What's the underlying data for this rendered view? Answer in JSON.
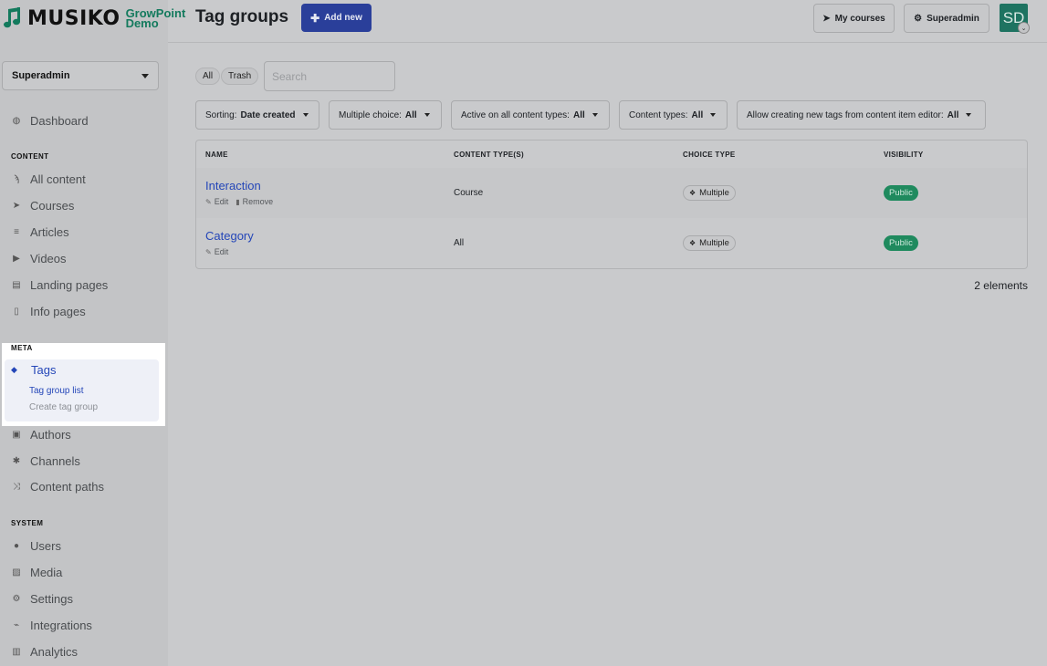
{
  "brand": {
    "name": "MUSIKO",
    "sub1": "GrowPoint",
    "sub2": "Demo"
  },
  "sidebar": {
    "role_select": "Superadmin",
    "dashboard": "Dashboard",
    "content_label": "CONTENT",
    "content_items": [
      "All content",
      "Courses",
      "Articles",
      "Videos",
      "Landing pages",
      "Info pages"
    ],
    "meta_label": "META",
    "tags": "Tags",
    "tags_sub_active": "Tag group list",
    "tags_sub_inactive": "Create tag group",
    "meta_items": [
      "Authors",
      "Channels",
      "Content paths"
    ],
    "system_label": "SYSTEM",
    "system_items": [
      "Users",
      "Media",
      "Settings",
      "Integrations",
      "Analytics"
    ]
  },
  "header": {
    "title": "Tag groups",
    "add_new": "Add new",
    "my_courses": "My courses",
    "superadmin": "Superadmin",
    "avatar": "SD"
  },
  "filters": {
    "all": "All",
    "trash": "Trash",
    "search_placeholder": "Search",
    "sorting_label": "Sorting:",
    "sorting_value": "Date created",
    "multiple_label": "Multiple choice:",
    "multiple_value": "All",
    "active_label": "Active on all content types:",
    "active_value": "All",
    "types_label": "Content types:",
    "types_value": "All",
    "allow_label": "Allow creating new tags from content item editor:",
    "allow_value": "All"
  },
  "table": {
    "columns": [
      "NAME",
      "CONTENT TYPE(S)",
      "CHOICE TYPE",
      "VISIBILITY"
    ],
    "rows": [
      {
        "name": "Interaction",
        "edit": "Edit",
        "remove": "Remove",
        "content_type": "Course",
        "choice": "Multiple",
        "visibility": "Public"
      },
      {
        "name": "Category",
        "edit": "Edit",
        "content_type": "All",
        "choice": "Multiple",
        "visibility": "Public"
      }
    ],
    "count": "2 elements"
  },
  "colors": {
    "accent": "#2446b8",
    "brand": "#137a5d",
    "public": "#1f8a5e",
    "primary_button": "#2a3f9a"
  }
}
